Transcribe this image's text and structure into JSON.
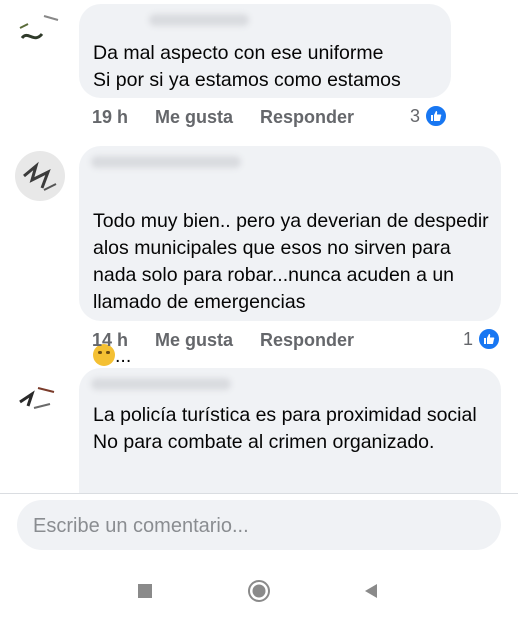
{
  "comments": [
    {
      "text": "Da mal aspecto con ese uniforme\nSi por si ya estamos como estamos",
      "time": "19 h",
      "like_label": "Me gusta",
      "reply_label": "Responder",
      "reaction_count": "3"
    },
    {
      "text": "Todo muy bien.. pero ya deverian  de despedir alos municipales que esos no sirven para nada solo para robar...nunca acuden a un llamado de emergencias",
      "emoji_suffix": "...",
      "time": "14 h",
      "like_label": "Me gusta",
      "reply_label": "Responder",
      "reaction_count": "1"
    },
    {
      "text": "La policía turística es para proximidad social No para combate al crimen organizado."
    }
  ],
  "composer": {
    "placeholder": "Escribe un comentario..."
  },
  "icons": {
    "reaction": "like-icon",
    "nav": [
      "recent-apps-icon",
      "home-icon",
      "back-icon"
    ]
  },
  "colors": {
    "bubble": "#f0f2f5",
    "like_blue": "#1877f2",
    "meta_gray": "#65676b"
  }
}
